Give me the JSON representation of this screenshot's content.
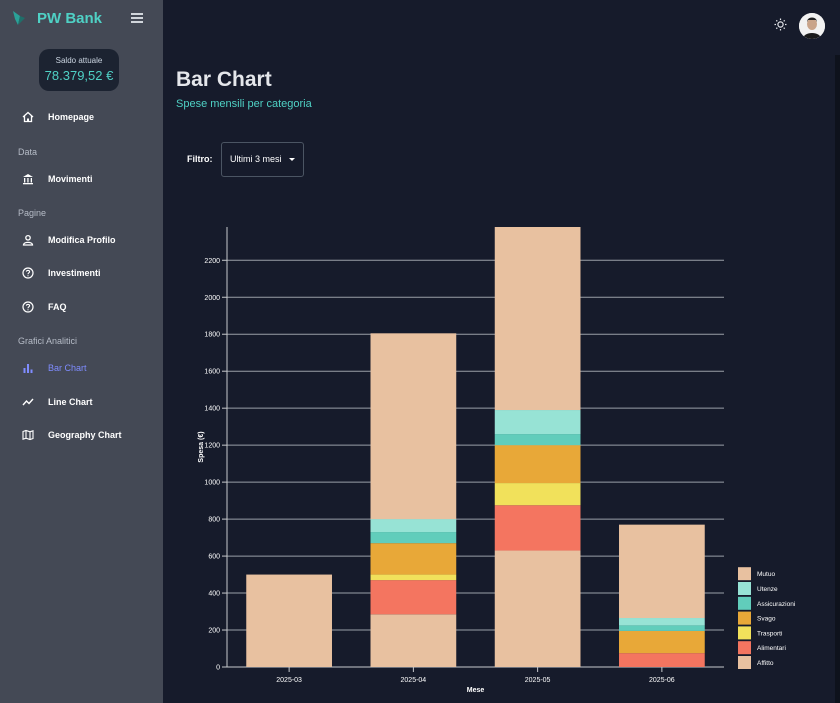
{
  "app": {
    "name": "PW Bank"
  },
  "balance": {
    "label": "Saldo attuale",
    "value": "78.379,52 €"
  },
  "nav": {
    "homepage": "Homepage",
    "section_data": "Data",
    "movimenti": "Movimenti",
    "section_pagine": "Pagine",
    "profilo": "Modifica Profilo",
    "investimenti": "Investimenti",
    "faq": "FAQ",
    "section_grafici": "Grafici Analitici",
    "bar_chart": "Bar Chart",
    "line_chart": "Line Chart",
    "geo_chart": "Geography Chart"
  },
  "icons": {
    "menu": "hamburger-icon",
    "home": "home-icon",
    "bank": "bank-icon",
    "user": "user-icon",
    "help": "help-circle-icon",
    "bar": "bar-chart-icon",
    "line": "line-chart-icon",
    "map": "map-icon",
    "theme": "sun-icon",
    "caret": "caret-down-icon"
  },
  "colors": {
    "accent": "#4fd1c5",
    "active_nav": "#7f8cff",
    "sidebar": "#444955",
    "background": "#161b2b"
  },
  "page": {
    "title": "Bar Chart",
    "subtitle": "Spese mensili per categoria"
  },
  "filter": {
    "label": "Filtro:",
    "value": "Ultimi 3 mesi"
  },
  "chart_data": {
    "type": "bar",
    "stacked": true,
    "categories": [
      "2025-03",
      "2025-04",
      "2025-05",
      "2025-06"
    ],
    "xlabel": "Mese",
    "ylabel": "Spesa (€)",
    "ylim": [
      0,
      2380
    ],
    "yticks": [
      0,
      200,
      400,
      600,
      800,
      1000,
      1200,
      1400,
      1600,
      1800,
      2000,
      2200
    ],
    "grid": true,
    "legend_position": "right-bottom",
    "series": [
      {
        "name": "Affitto",
        "color": "#e8c1a0",
        "values": [
          500,
          285,
          630,
          0
        ]
      },
      {
        "name": "Alimentari",
        "color": "#f47560",
        "values": [
          0,
          185,
          245,
          75
        ]
      },
      {
        "name": "Trasporti",
        "color": "#f1e15b",
        "values": [
          0,
          30,
          120,
          0
        ]
      },
      {
        "name": "Svago",
        "color": "#e8a838",
        "values": [
          0,
          170,
          205,
          120
        ]
      },
      {
        "name": "Assicurazioni",
        "color": "#61cdbb",
        "values": [
          0,
          60,
          60,
          30
        ]
      },
      {
        "name": "Utenze",
        "color": "#97e3d5",
        "values": [
          0,
          70,
          130,
          40
        ]
      },
      {
        "name": "Mutuo",
        "color": "#e8c1a0",
        "values": [
          0,
          1005,
          990,
          505
        ]
      }
    ]
  }
}
